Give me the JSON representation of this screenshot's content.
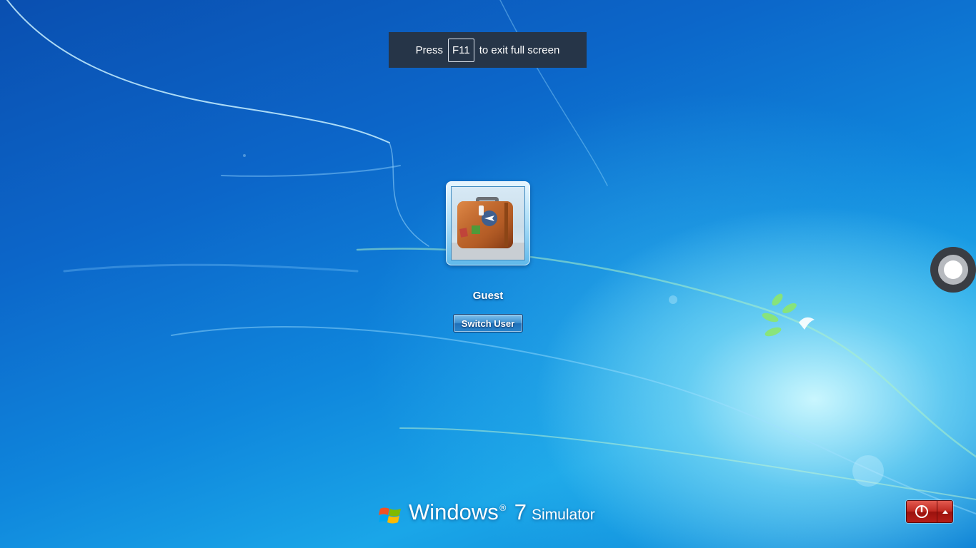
{
  "fullscreen_hint": {
    "prefix": "Press",
    "key": "F11",
    "suffix": "to exit full screen"
  },
  "user": {
    "name": "Guest",
    "switch_label": "Switch User",
    "avatar": "suitcase-picture"
  },
  "branding": {
    "windows": "Windows",
    "registered": "®",
    "version": "7",
    "product": "Simulator"
  },
  "icons": {
    "shutdown": "power-icon",
    "options": "triangle-up-icon",
    "logo": "windows-flag-icon",
    "touch": "touch-circle-icon"
  },
  "colors": {
    "hint_bg": "#263548",
    "shutdown_red": "#c02a22",
    "switch_blue": "#2b85cb"
  }
}
